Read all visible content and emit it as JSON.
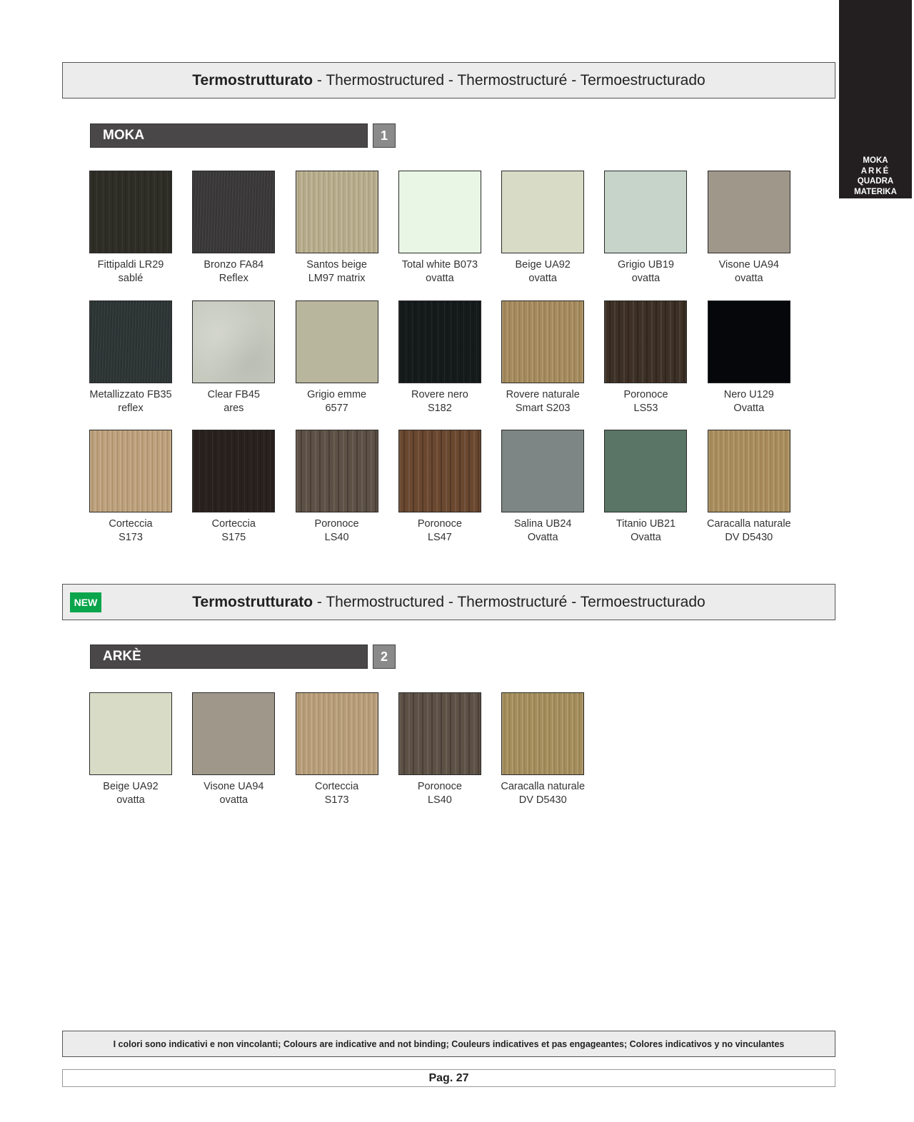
{
  "side_tab": {
    "items": [
      "MOKA",
      "ARKÉ",
      "QUADRA",
      "MATERIKA"
    ]
  },
  "section1": {
    "title_bold": "Termostrutturato",
    "title_rest": " - Thermostructured - Thermostructuré - Termoestructurado",
    "series_name": "MOKA",
    "series_number": "1",
    "swatches": [
      {
        "line1": "Fittipaldi LR29",
        "line2": "sablé",
        "color": "#2f2e26",
        "texture": "wood-dark"
      },
      {
        "line1": "Bronzo FA84",
        "line2": "Reflex",
        "color": "#3b3939",
        "texture": "wood-fine"
      },
      {
        "line1": "Santos beige",
        "line2": "LM97 matrix",
        "color": "#b7ad8d",
        "texture": "wood-light"
      },
      {
        "line1": "Total white B073",
        "line2": "ovatta",
        "color": "#e9f6e6",
        "texture": "plain"
      },
      {
        "line1": "Beige UA92",
        "line2": "ovatta",
        "color": "#d8dcc6",
        "texture": "plain"
      },
      {
        "line1": "Grigio UB19",
        "line2": "ovatta",
        "color": "#c6d4c9",
        "texture": "plain"
      },
      {
        "line1": "Visone UA94",
        "line2": "ovatta",
        "color": "#9f978a",
        "texture": "plain"
      },
      {
        "line1": "Metallizzato FB35",
        "line2": "reflex",
        "color": "#2d3535",
        "texture": "wood-fine"
      },
      {
        "line1": "Clear FB45",
        "line2": "ares",
        "color": "#c6c9be",
        "texture": "stone"
      },
      {
        "line1": "Grigio emme",
        "line2": "6577",
        "color": "#b9b69e",
        "texture": "plain"
      },
      {
        "line1": "Rovere nero",
        "line2": "S182",
        "color": "#151a1b",
        "texture": "wood-dark"
      },
      {
        "line1": "Rovere naturale",
        "line2": "Smart S203",
        "color": "#a48a5c",
        "texture": "wood-light"
      },
      {
        "line1": "Poronoce",
        "line2": "LS53",
        "color": "#3d3025",
        "texture": "wood-stripe"
      },
      {
        "line1": "Nero U129",
        "line2": "Ovatta",
        "color": "#06070b",
        "texture": "plain"
      },
      {
        "line1": "Corteccia",
        "line2": "S173",
        "color": "#bca07b",
        "texture": "wood-light"
      },
      {
        "line1": "Corteccia",
        "line2": "S175",
        "color": "#29211d",
        "texture": "wood-dark"
      },
      {
        "line1": "Poronoce",
        "line2": "LS40",
        "color": "#5d5146",
        "texture": "wood-stripe"
      },
      {
        "line1": "Poronoce",
        "line2": "LS47",
        "color": "#6a4830",
        "texture": "wood-stripe"
      },
      {
        "line1": "Salina UB24",
        "line2": "Ovatta",
        "color": "#7d8684",
        "texture": "plain"
      },
      {
        "line1": "Titanio UB21",
        "line2": "Ovatta",
        "color": "#5a7565",
        "texture": "plain"
      },
      {
        "line1": "Caracalla naturale",
        "line2": "DV D5430",
        "color": "#a98d5d",
        "texture": "wood-light"
      }
    ]
  },
  "section2": {
    "badge": "NEW",
    "title_bold": "Termostrutturato",
    "title_rest": " - Thermostructured - Thermostructuré - Termoestructurado",
    "series_name": "ARKÈ",
    "series_number": "2",
    "swatches": [
      {
        "line1": "Beige UA92",
        "line2": "ovatta",
        "color": "#d8dcc6",
        "texture": "plain"
      },
      {
        "line1": "Visone UA94",
        "line2": "ovatta",
        "color": "#9f978a",
        "texture": "plain"
      },
      {
        "line1": "Corteccia",
        "line2": "S173",
        "color": "#b89e7a",
        "texture": "wood-light"
      },
      {
        "line1": "Poronoce",
        "line2": "LS40",
        "color": "#5d5146",
        "texture": "wood-stripe"
      },
      {
        "line1": "Caracalla naturale",
        "line2": "DV D5430",
        "color": "#a48d5c",
        "texture": "wood-light"
      }
    ]
  },
  "footer": {
    "note": "I colori sono indicativi e non vincolanti; Colours are indicative and not binding; Couleurs indicatives et pas engageantes; Colores indicativos y no vinculantes",
    "page": "Pag. 27"
  }
}
